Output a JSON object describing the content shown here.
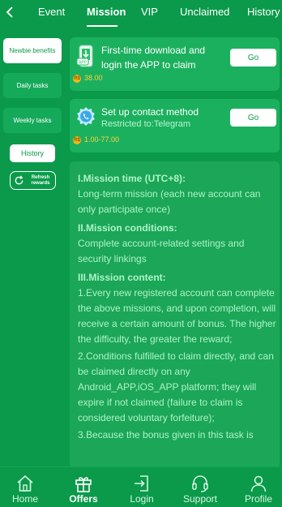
{
  "tabs": [
    {
      "label": "Event"
    },
    {
      "label": "Mission"
    },
    {
      "label": "VIP"
    },
    {
      "label": "Unclaimed"
    },
    {
      "label": "History"
    }
  ],
  "active_tab": "Mission",
  "sidebar": {
    "items": [
      {
        "label": "Newbie benefits",
        "active": true
      },
      {
        "label": "Daily tasks",
        "active": false
      },
      {
        "label": "Weekly tasks",
        "active": false
      }
    ],
    "history_label": "History",
    "refresh_label": "Refresh rewards"
  },
  "missions": [
    {
      "title": "First-time download and login the APP to claim",
      "subtitle": "",
      "currency_symbol": "R$",
      "reward": "38.00",
      "button": "Go",
      "icon": "phone-download-icon"
    },
    {
      "title": "Set up contact method",
      "subtitle": "Restricted to:Telegram",
      "currency_symbol": "R$",
      "reward": "1.00-77.00",
      "button": "Go",
      "icon": "contact-phone-icon"
    }
  ],
  "rules": {
    "h1": "I.Mission time (UTC+8):",
    "p1": "Long-term mission (each new account can only participate once)",
    "h2": "II.Mission conditions:",
    "p2": "Complete account-related settings and security linkings",
    "h3": "III.Mission content:",
    "p3": "1.Every new registered account can complete the above missions, and upon completion, will receive a certain amount of bonus. The higher the difficulty, the greater the reward;",
    "p4": "2.Conditions fulfilled to claim directly, and can be claimed directly on any Android_APP,iOS_APP platform; they will expire if not claimed (failure to claim is considered voluntary forfeiture);",
    "p5": "3.Because the bonus given in this task is"
  },
  "bottom_nav": [
    {
      "label": "Home",
      "icon": "home-icon"
    },
    {
      "label": "Offers",
      "icon": "gift-icon",
      "active": true
    },
    {
      "label": "Login",
      "icon": "login-icon"
    },
    {
      "label": "Support",
      "icon": "headset-icon"
    },
    {
      "label": "Profile",
      "icon": "profile-icon"
    }
  ],
  "colors": {
    "background": "#0a9a4a",
    "card": "#1bb05e",
    "reward": "#ffd23f",
    "accent_text": "#aef3c7"
  }
}
